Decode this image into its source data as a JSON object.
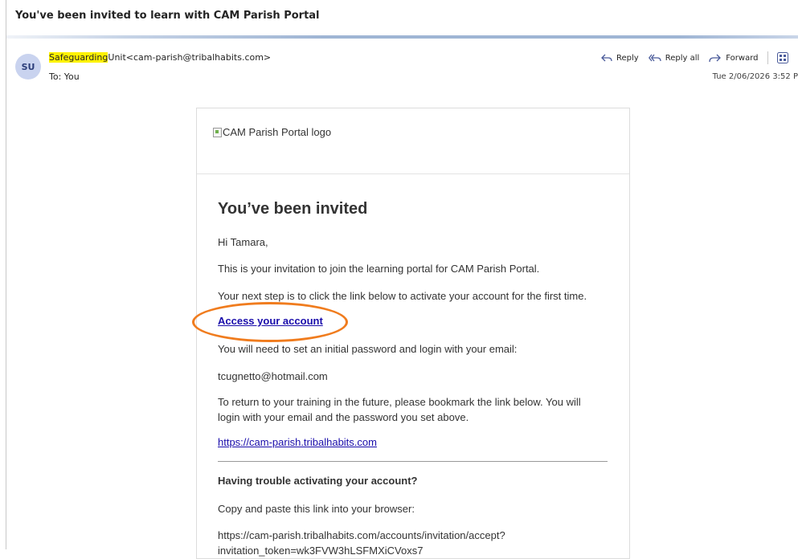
{
  "email": {
    "subject": "You've been invited to learn with CAM Parish Portal",
    "avatar_initials": "SU",
    "sender_highlight": "Safeguarding",
    "sender_rest": "Unit<cam-parish@tribalhabits.com>",
    "to": "To:  You",
    "date": "Tue 2/06/2026 3:52 P"
  },
  "actions": {
    "reply": "Reply",
    "reply_all": "Reply all",
    "forward": "Forward"
  },
  "content": {
    "logo_alt": "CAM Parish Portal logo",
    "heading": "You’ve been invited",
    "greeting": "Hi Tamara,",
    "intro": "This is your invitation to join the learning portal for CAM Parish Portal.",
    "next_step": "Your next step is to click the link below to activate your account for the first time.",
    "access_link": "Access your account",
    "password_note": "You will need to set an initial password and login with your email:",
    "email_address": "tcugnetto@hotmail.com",
    "bookmark_note": "To return to your training in the future, please bookmark the link below. You will login with your email and the password you set above.",
    "portal_link": "https://cam-parish.tribalhabits.com",
    "trouble_heading": "Having trouble activating your account?",
    "copy_note": "Copy and paste this link into your browser:",
    "invite_url_1": "https://cam-parish.tribalhabits.com/accounts/invitation/accept?",
    "invite_url_2": "invitation_token=wk3FVW3hLSFMXiCVoxs7"
  },
  "colors": {
    "highlight": "#fff200",
    "annotation_ring": "#f07c1e",
    "link": "#1a0dab",
    "avatar_bg": "#c9d3ef"
  }
}
